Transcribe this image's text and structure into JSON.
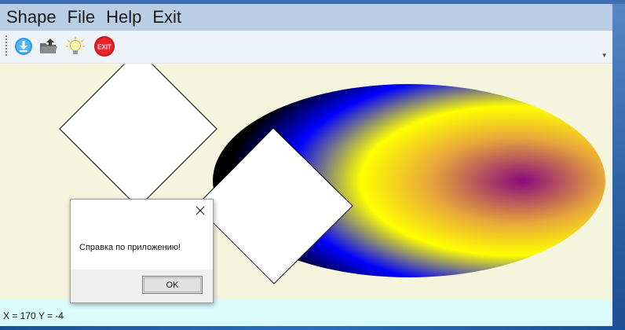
{
  "menu": {
    "items": [
      "Shape",
      "File",
      "Help",
      "Exit"
    ]
  },
  "toolbar": {
    "buttons": [
      {
        "icon": "download-icon"
      },
      {
        "icon": "folder-open-icon"
      },
      {
        "icon": "lightbulb-icon"
      },
      {
        "icon": "exit-icon",
        "label": "EXIT"
      }
    ],
    "overflow_icon": "chevron-down-icon"
  },
  "canvas": {
    "shapes": [
      {
        "kind": "diamond",
        "fill": "#ffffff",
        "stroke": "#000000"
      },
      {
        "kind": "diamond",
        "fill": "#ffffff",
        "stroke": "#000000"
      },
      {
        "kind": "ellipse",
        "gradient": [
          "#8a0a7c",
          "#e9a83a",
          "#ffff00",
          "#0000ff",
          "#000000"
        ]
      }
    ]
  },
  "status": {
    "text": "X = 170 Y = -4"
  },
  "dialog": {
    "message": "Справка по приложению!",
    "ok_label": "OK"
  }
}
